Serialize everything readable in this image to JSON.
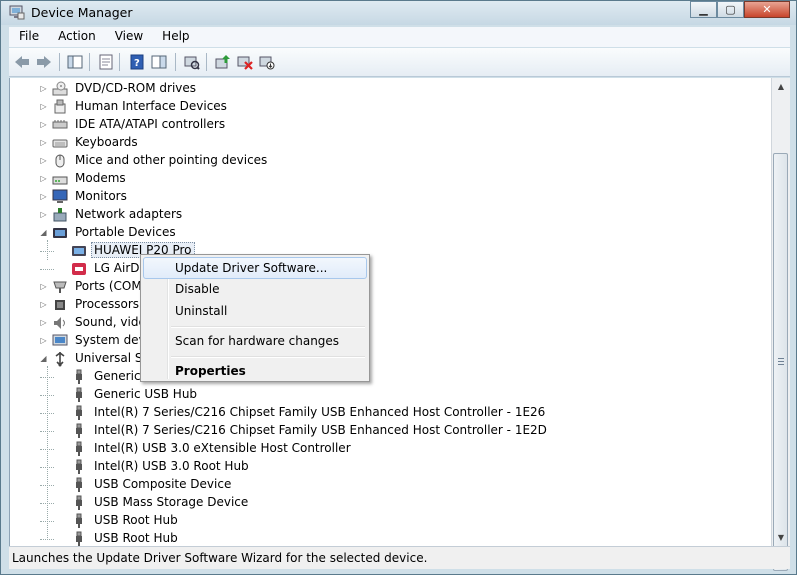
{
  "window": {
    "title": "Device Manager"
  },
  "menu": [
    "File",
    "Action",
    "View",
    "Help"
  ],
  "toolbar_icons": [
    "back-icon",
    "forward-icon",
    "show-hide-console-tree-icon",
    "properties-icon",
    "help-icon",
    "show-action-pane-icon",
    "scan-hardware-icon",
    "update-driver-icon",
    "uninstall-icon",
    "disable-icon"
  ],
  "tree": [
    {
      "label": "DVD/CD-ROM drives",
      "level": 0,
      "state": "collapsed",
      "icon": "dvd-drive-icon"
    },
    {
      "label": "Human Interface Devices",
      "level": 0,
      "state": "collapsed",
      "icon": "hid-icon"
    },
    {
      "label": "IDE ATA/ATAPI controllers",
      "level": 0,
      "state": "collapsed",
      "icon": "ide-controller-icon"
    },
    {
      "label": "Keyboards",
      "level": 0,
      "state": "collapsed",
      "icon": "keyboard-icon"
    },
    {
      "label": "Mice and other pointing devices",
      "level": 0,
      "state": "collapsed",
      "icon": "mouse-icon"
    },
    {
      "label": "Modems",
      "level": 0,
      "state": "collapsed",
      "icon": "modem-icon"
    },
    {
      "label": "Monitors",
      "level": 0,
      "state": "collapsed",
      "icon": "monitor-icon"
    },
    {
      "label": "Network adapters",
      "level": 0,
      "state": "collapsed",
      "icon": "network-adapter-icon"
    },
    {
      "label": "Portable Devices",
      "level": 0,
      "state": "expanded",
      "icon": "portable-devices-icon"
    },
    {
      "label": "HUAWEI P20 Pro",
      "level": 1,
      "state": "leaf",
      "icon": "phone-device-icon",
      "selected": true
    },
    {
      "label": "LG AirDri",
      "level": 1,
      "state": "leaf",
      "icon": "lg-device-icon"
    },
    {
      "label": "Ports (COM",
      "level": 0,
      "state": "collapsed",
      "icon": "port-icon"
    },
    {
      "label": "Processors",
      "level": 0,
      "state": "collapsed",
      "icon": "processor-icon"
    },
    {
      "label": "Sound, video",
      "level": 0,
      "state": "collapsed",
      "icon": "sound-icon"
    },
    {
      "label": "System devic",
      "level": 0,
      "state": "collapsed",
      "icon": "system-devices-icon"
    },
    {
      "label": "Universal Ser",
      "level": 0,
      "state": "expanded",
      "icon": "usb-controller-icon"
    },
    {
      "label": "Generic U",
      "level": 1,
      "state": "leaf",
      "icon": "usb-plug-icon"
    },
    {
      "label": "Generic USB Hub",
      "level": 1,
      "state": "leaf",
      "icon": "usb-plug-icon"
    },
    {
      "label": "Intel(R) 7 Series/C216 Chipset Family USB Enhanced Host Controller - 1E26",
      "level": 1,
      "state": "leaf",
      "icon": "usb-plug-icon"
    },
    {
      "label": "Intel(R) 7 Series/C216 Chipset Family USB Enhanced Host Controller - 1E2D",
      "level": 1,
      "state": "leaf",
      "icon": "usb-plug-icon"
    },
    {
      "label": "Intel(R) USB 3.0 eXtensible Host Controller",
      "level": 1,
      "state": "leaf",
      "icon": "usb-plug-icon"
    },
    {
      "label": "Intel(R) USB 3.0 Root Hub",
      "level": 1,
      "state": "leaf",
      "icon": "usb-plug-icon"
    },
    {
      "label": "USB Composite Device",
      "level": 1,
      "state": "leaf",
      "icon": "usb-plug-icon"
    },
    {
      "label": "USB Mass Storage Device",
      "level": 1,
      "state": "leaf",
      "icon": "usb-plug-icon"
    },
    {
      "label": "USB Root Hub",
      "level": 1,
      "state": "leaf",
      "icon": "usb-plug-icon"
    },
    {
      "label": "USB Root Hub",
      "level": 1,
      "state": "leaf",
      "icon": "usb-plug-icon"
    }
  ],
  "context_menu": {
    "update": "Update Driver Software...",
    "disable": "Disable",
    "uninstall": "Uninstall",
    "scan": "Scan for hardware changes",
    "properties": "Properties"
  },
  "status": "Launches the Update Driver Software Wizard for the selected device."
}
